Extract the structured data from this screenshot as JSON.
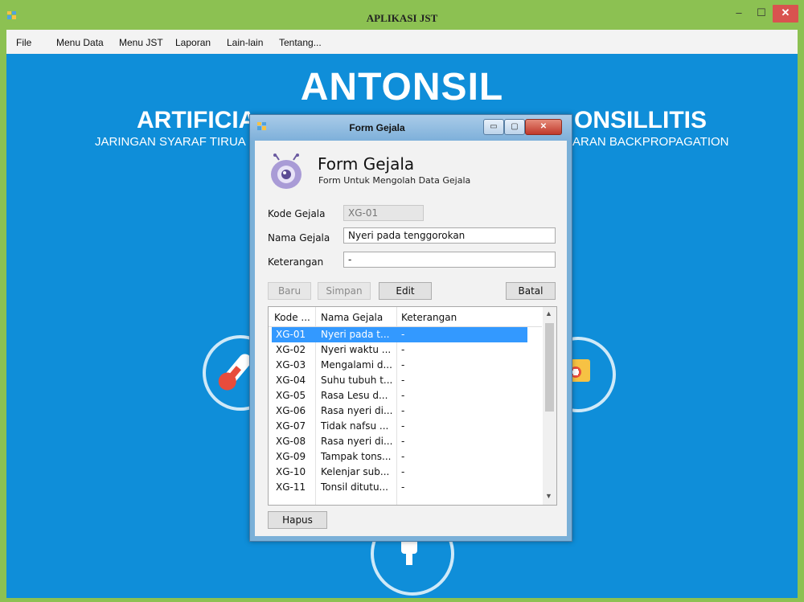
{
  "window": {
    "title": "APLIKASI JST",
    "min_glyph": "–",
    "max_glyph": "☐",
    "close_glyph": "✕"
  },
  "menu": [
    "File",
    "Menu Data",
    "Menu JST",
    "Laporan",
    "Lain-lain",
    "Tentang..."
  ],
  "banner": {
    "line1": "ANTONSIL",
    "line2_left": "ARTIFICIA",
    "line2_right": "ONSILLITIS",
    "line3_left": "JARINGAN SYARAF TIRUA",
    "line3_right": "ARAN BACKPROPAGATION"
  },
  "dialog": {
    "title": "Form Gejala",
    "min_glyph": "▭",
    "max_glyph": "▢",
    "close_glyph": "✕",
    "header_title": "Form Gejala",
    "header_subtitle": "Form Untuk Mengolah Data Gejala",
    "fields": {
      "kode_label": "Kode Gejala",
      "kode_value": "XG-01",
      "nama_label": "Nama Gejala",
      "nama_value": "Nyeri pada tenggorokan",
      "ket_label": "Keterangan",
      "ket_value": "-"
    },
    "buttons": {
      "baru": "Baru",
      "simpan": "Simpan",
      "edit": "Edit",
      "batal": "Batal",
      "hapus": "Hapus"
    },
    "grid": {
      "columns": [
        "Kode ...",
        "Nama Gejala",
        "Keterangan"
      ],
      "rows": [
        [
          "XG-01",
          "Nyeri pada t...",
          "-"
        ],
        [
          "XG-02",
          "Nyeri waktu ...",
          "-"
        ],
        [
          "XG-03",
          "Mengalami d...",
          "-"
        ],
        [
          "XG-04",
          "Suhu tubuh t...",
          "-"
        ],
        [
          "XG-05",
          "Rasa Lesu d...",
          "-"
        ],
        [
          "XG-06",
          "Rasa nyeri di...",
          "-"
        ],
        [
          "XG-07",
          "Tidak nafsu ...",
          "-"
        ],
        [
          "XG-08",
          "Rasa nyeri di...",
          "-"
        ],
        [
          "XG-09",
          "Tampak tons...",
          "-"
        ],
        [
          "XG-10",
          "Kelenjar sub...",
          "-"
        ],
        [
          "XG-11",
          "Tonsil ditutu...",
          "-"
        ]
      ],
      "selected_row": 0,
      "scroll_up": "▲",
      "scroll_down": "▼"
    }
  },
  "colors": {
    "titlebar": "#8cc152",
    "content_bg": "#0f8ed9",
    "selection": "#3399ff"
  }
}
